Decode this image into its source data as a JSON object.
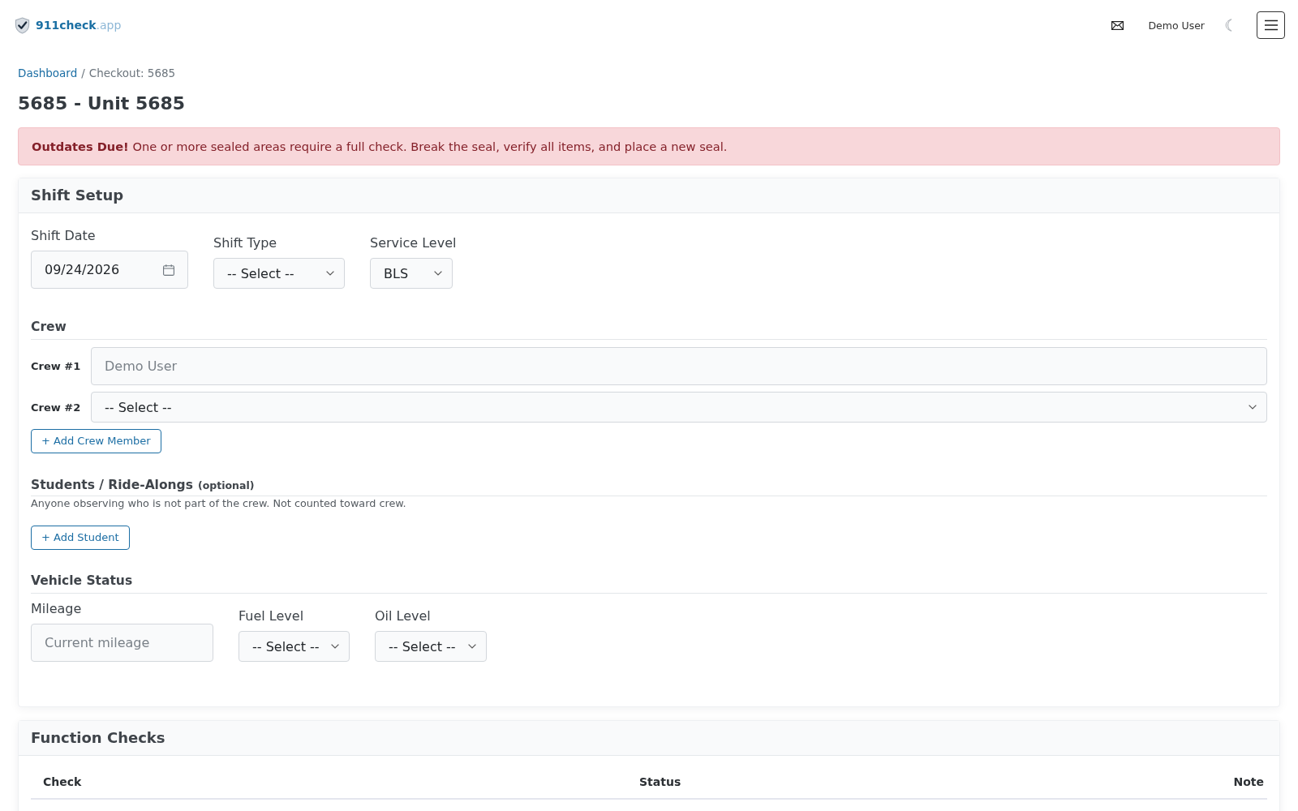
{
  "navbar": {
    "brand": {
      "name": "911check",
      "suffix": ".app"
    },
    "user": "Demo User"
  },
  "breadcrumb": {
    "separator": "/",
    "items": [
      {
        "label": "Dashboard",
        "kind": "link"
      },
      {
        "label": "Checkout: 5685",
        "kind": "current"
      }
    ]
  },
  "page_title": "5685 - Unit 5685",
  "alert": {
    "message": "**Outdates Due!** One or more sealed areas require a full check. Break the seal, verify all items, and place a new seal."
  },
  "shift_setup": {
    "title": "Shift Setup",
    "fields": [
      {
        "label": "Shift Date",
        "kind": "date",
        "value": "09/24/2026"
      },
      {
        "label": "Shift Type",
        "kind": "select",
        "value": "-- Select --"
      },
      {
        "label": "Service Level",
        "kind": "select",
        "value": "BLS"
      }
    ],
    "crew": {
      "title": "Crew",
      "members": [
        {
          "label": "Crew #1",
          "kind": "text",
          "placeholder": "Demo User"
        },
        {
          "label": "Crew #2",
          "kind": "select",
          "value": "-- Select --"
        }
      ],
      "add_button": "+ Add Crew Member"
    },
    "students": {
      "title": "Students / Ride-Alongs",
      "note": "(optional)",
      "description": "Anyone observing who is not part of the crew. Not counted toward crew.",
      "add_button": "+ Add Student"
    },
    "vehicle_status": {
      "title": "Vehicle Status",
      "fields": [
        {
          "label": "Mileage",
          "kind": "text",
          "placeholder": "Current mileage"
        },
        {
          "label": "Fuel Level",
          "kind": "select",
          "value": "-- Select --"
        },
        {
          "label": "Oil Level",
          "kind": "select",
          "value": "-- Select --"
        }
      ]
    }
  },
  "function_checks": {
    "title": "Function Checks",
    "table": {
      "columns": [
        "Check",
        "Status",
        "Note"
      ]
    }
  }
}
